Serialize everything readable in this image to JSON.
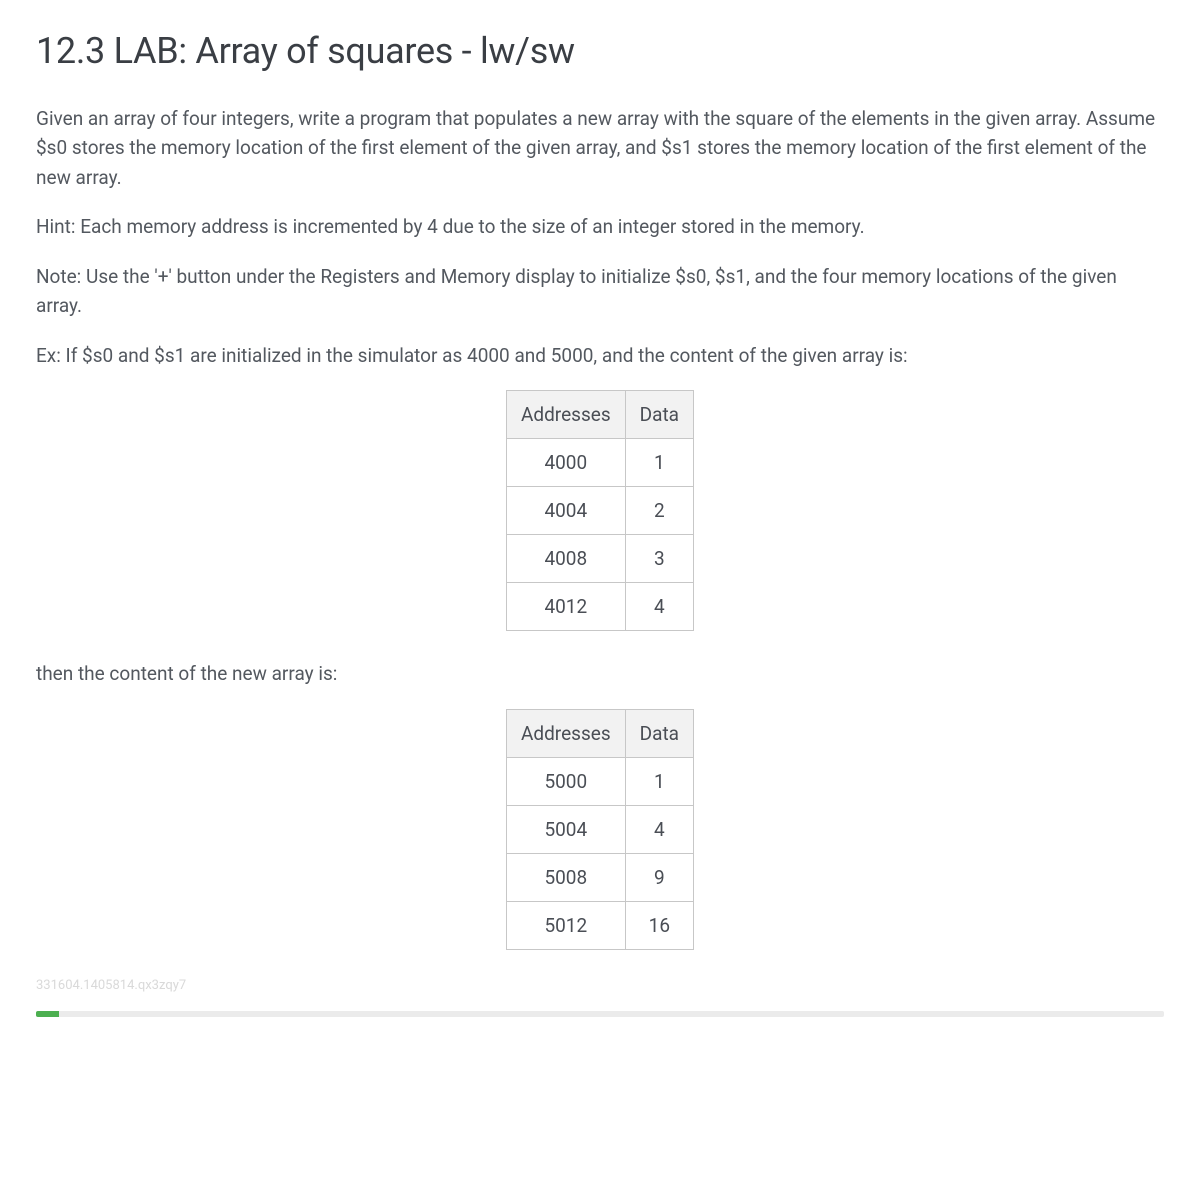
{
  "title": "12.3 LAB: Array of squares - lw/sw",
  "paragraphs": {
    "intro": "Given an array of four integers, write a program that populates a new array with the square of the elements in the given array. Assume $s0 stores the memory location of the first element of the given array, and $s1 stores the memory location of the first element of the new array.",
    "hint": "Hint: Each memory address is incremented by 4 due to the size of an integer stored in the memory.",
    "note": "Note: Use the '+' button under the Registers and Memory display to initialize $s0, $s1, and the four memory locations of the given array.",
    "example_intro": "Ex: If $s0 and $s1 are initialized in the simulator as 4000 and 5000, and the content of the given array is:",
    "then_text": "then the content of the new array is:"
  },
  "table_headers": {
    "addresses": "Addresses",
    "data": "Data"
  },
  "input_array": [
    {
      "address": "4000",
      "value": "1"
    },
    {
      "address": "4004",
      "value": "2"
    },
    {
      "address": "4008",
      "value": "3"
    },
    {
      "address": "4012",
      "value": "4"
    }
  ],
  "output_array": [
    {
      "address": "5000",
      "value": "1"
    },
    {
      "address": "5004",
      "value": "4"
    },
    {
      "address": "5008",
      "value": "9"
    },
    {
      "address": "5012",
      "value": "16"
    }
  ],
  "watermark": "331604.1405814.qx3zqy7"
}
